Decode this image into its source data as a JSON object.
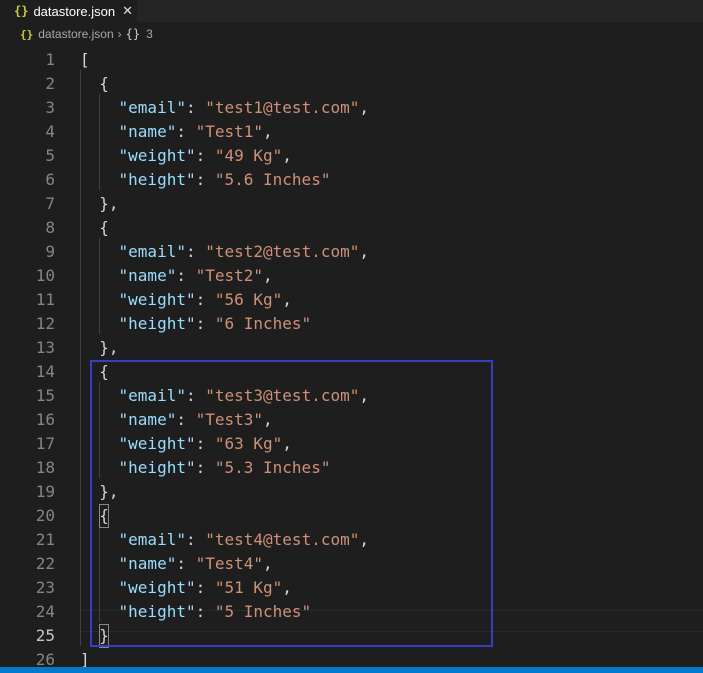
{
  "tab": {
    "icon": "{}",
    "label": "datastore.json",
    "close": "✕"
  },
  "breadcrumb": {
    "file_icon": "{}",
    "file": "datastore.json",
    "separator": "›",
    "object_icon": "{}",
    "object": "3"
  },
  "colors": {
    "key": "#9cdcfe",
    "string": "#ce9178",
    "punct": "#d4d4d4",
    "highlight_box": "#3a3cc4",
    "status_bar": "#007acc"
  },
  "records": [
    {
      "open": "{",
      "close": "},",
      "email": "\"test1@test.com\"",
      "name": "\"Test1\"",
      "weight": "\"49 Kg\"",
      "height": "\"5.6 Inches\""
    },
    {
      "open": "{",
      "close": "},",
      "email": "\"test2@test.com\"",
      "name": "\"Test2\"",
      "weight": "\"56 Kg\"",
      "height": "\"6 Inches\""
    },
    {
      "open": "{",
      "close": "},",
      "email": "\"test3@test.com\"",
      "name": "\"Test3\"",
      "weight": "\"63 Kg\"",
      "height": "\"5.3 Inches\""
    },
    {
      "open": "{",
      "close": "}",
      "email": "\"test4@test.com\"",
      "name": "\"Test4\"",
      "weight": "\"51 Kg\"",
      "height": "\"5 Inches\""
    }
  ],
  "keys": {
    "email": "\"email\"",
    "name": "\"name\"",
    "weight": "\"weight\"",
    "height": "\"height\""
  },
  "array_open": "[",
  "array_close": "]",
  "line_numbers": [
    "1",
    "2",
    "3",
    "4",
    "5",
    "6",
    "7",
    "8",
    "9",
    "10",
    "11",
    "12",
    "13",
    "14",
    "15",
    "16",
    "17",
    "18",
    "19",
    "20",
    "21",
    "22",
    "23",
    "24",
    "25",
    "26"
  ]
}
